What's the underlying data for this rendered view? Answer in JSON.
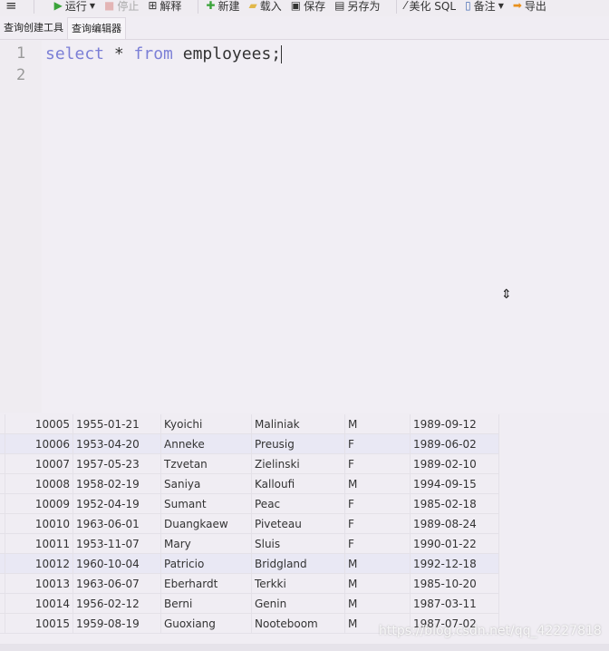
{
  "toolbar": {
    "menu_icon": "hamburger-icon",
    "run": "运行",
    "stop": "停止",
    "explain": "解释",
    "new": "新建",
    "load": "载入",
    "save": "保存",
    "save_as": "另存为",
    "beautify": "美化 SQL",
    "comment": "备注",
    "export": "导出"
  },
  "tabs": [
    {
      "label": "查询创建工具"
    },
    {
      "label": "查询编辑器",
      "active": true
    }
  ],
  "editor": {
    "line_numbers": [
      "1",
      "2"
    ],
    "kw1": "select",
    "star": " * ",
    "kw2": "from",
    "rest": " employees;"
  },
  "results": {
    "rows": [
      [
        "10005",
        "1955-01-21",
        "Kyoichi",
        "Maliniak",
        "M",
        "1989-09-12"
      ],
      [
        "10006",
        "1953-04-20",
        "Anneke",
        "Preusig",
        "F",
        "1989-06-02"
      ],
      [
        "10007",
        "1957-05-23",
        "Tzvetan",
        "Zielinski",
        "F",
        "1989-02-10"
      ],
      [
        "10008",
        "1958-02-19",
        "Saniya",
        "Kalloufi",
        "M",
        "1994-09-15"
      ],
      [
        "10009",
        "1952-04-19",
        "Sumant",
        "Peac",
        "F",
        "1985-02-18"
      ],
      [
        "10010",
        "1963-06-01",
        "Duangkaew",
        "Piveteau",
        "F",
        "1989-08-24"
      ],
      [
        "10011",
        "1953-11-07",
        "Mary",
        "Sluis",
        "F",
        "1990-01-22"
      ],
      [
        "10012",
        "1960-10-04",
        "Patricio",
        "Bridgland",
        "M",
        "1992-12-18"
      ],
      [
        "10013",
        "1963-06-07",
        "Eberhardt",
        "Terkki",
        "M",
        "1985-10-20"
      ],
      [
        "10014",
        "1956-02-12",
        "Berni",
        "Genin",
        "M",
        "1987-03-11"
      ],
      [
        "10015",
        "1959-08-19",
        "Guoxiang",
        "Nooteboom",
        "M",
        "1987-07-02"
      ]
    ],
    "highlighted_rows": [
      1,
      7
    ]
  },
  "watermark": "https://blog.csdn.net/qq_42227818"
}
